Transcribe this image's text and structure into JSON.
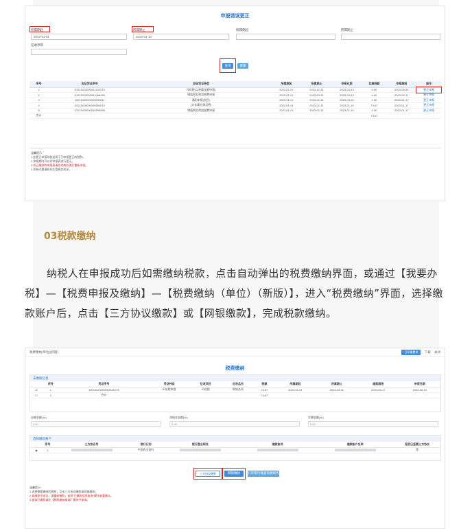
{
  "section": {
    "heading": "03税款缴纳",
    "paragraph": "纳税人在申报成功后如需缴纳税款，点击自动弹出的税费缴纳界面，或通过【我要办税】—【税费申报及缴纳】—【税费缴纳（单位）（新版）】，进入“税费缴纳”界面，选择缴款账户后，点击【三方协议缴款】或【网银缴款】，完成税款缴纳。"
  },
  "shot1": {
    "title": "申报错误更正",
    "fields": [
      {
        "label": "所属期起",
        "value": "2023-01-01"
      },
      {
        "label": "所属期止",
        "value": "2023-01-10"
      },
      {
        "label": "所属期起",
        "value": ""
      },
      {
        "label": "所属期止",
        "value": ""
      }
    ],
    "project_label": "征收项目",
    "query_button": "查询",
    "reset_button": "重置",
    "table": {
      "headers": [
        "序号",
        "应征凭证序号",
        "应征凭证种类",
        "所属期起",
        "所属期止",
        "申报日期",
        "实缴税额",
        "申报期限",
        "操作"
      ],
      "rows": [
        [
          "1",
          "10013423000001241076",
          "印花税(以账载金额申报)",
          "2023-01-01",
          "2023-12-31",
          "2023-04-19",
          "0.00",
          "2023-06-30",
          "更正申报"
        ],
        [
          "2",
          "10013423000001068436",
          "增值税及附加税费申报",
          "2023-01-01",
          "2023-03-31",
          "2023-04-19",
          "0.00",
          "2023-04-17",
          "更正申报"
        ],
        [
          "3",
          "10213420000000690611",
          "通用申报(税目)",
          "2023-01-01",
          "2023-01-31",
          "2023-03-10",
          "0.00",
          "2023-01-17",
          "更正申报"
        ],
        [
          "4",
          "10213420000000954015",
          "(文化事业建设费)",
          "2023-01-01",
          "2023-01-31",
          "2023-01-10",
          "73.67",
          "2023-01-17",
          "更正申报"
        ],
        [
          "5",
          "10213420000000990088",
          "增值税及附加税费申报",
          "2023-01-01",
          "2023-01-31",
          "2023-01-10",
          "0.00",
          "2023-01-17",
          "更正申报"
        ]
      ],
      "total_label": "合计",
      "total_value": "73.67"
    },
    "notes": [
      "温馨提示：",
      "1.此更正申报功能适用于已申报更正的税种。",
      "2.申报期内可以对申报表进行更正。",
      "3.如已缴款的申报表请先作废处理后重新申报。",
      "4.如有问题请联系主管税务机关。"
    ]
  },
  "shot2": {
    "window_title": "税费缴纳(单位)(新版)",
    "top_actions": [
      "打印缴费单",
      "下载",
      "关闭"
    ],
    "title": "税费缴纳",
    "section1": "未缴税信息",
    "table1_headers": [
      "序号",
      "凭证序号",
      "凭证种类",
      "征收项目",
      "征收品目",
      "税额",
      "所属期起",
      "所属期止",
      "缴款期限",
      "申报日期"
    ],
    "table1_rows": [
      [
        "1",
        "10013423000002541078",
        "印花税申报",
        "印花税",
        "购销合同",
        "73.67",
        "2023-01-01",
        "2023-03-31",
        "2023-05-17",
        "2023-05-10"
      ],
      [
        "2",
        "合计",
        "",
        "",
        "",
        "73.67",
        "",
        "",
        "",
        ""
      ]
    ],
    "sum_labels": [
      "应缴金额(元)",
      "滞纳金金额(元)",
      "实缴金额(元)"
    ],
    "sum_values": [
      "0.00",
      "0.00",
      "0.00"
    ],
    "section2": "选择缴款账户",
    "table2_headers": [
      "序号",
      "三方协议号",
      "银行行别",
      "银行营业网点",
      "缴款账号",
      "缴款账户名称",
      "是否已签署三方协议"
    ],
    "table2_rows": [
      [
        "1",
        "",
        "中国农业银行",
        "",
        "",
        "",
        "是"
      ]
    ],
    "buttons": [
      "三方协议缴款",
      "网银缴款",
      "打印银行端查询缴税凭证"
    ],
    "notes": [
      "温馨提示：",
      "1.选择需要缴纳的税款，点击三方协议缴款或网银缴款。",
      "2.如缴款不成功，请重新缴款，或到“已缴款信息查询”模块查看确认。",
      "3.查询已缴款请在【税款缴纳查询】模块中查询。"
    ]
  },
  "colors": {
    "accent": "#2a7ad0",
    "highlight": "#e02020",
    "heading": "#b58a3c"
  }
}
